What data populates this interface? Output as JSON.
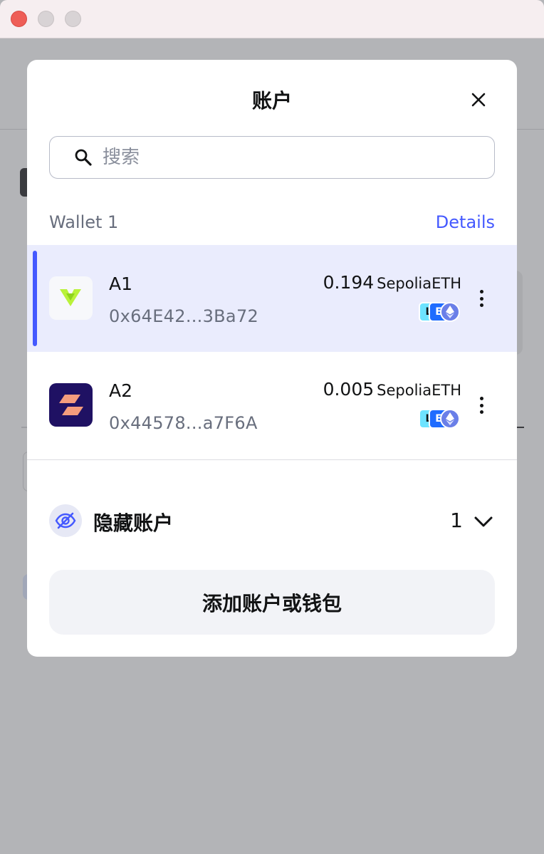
{
  "modal": {
    "title": "账户",
    "search_placeholder": "搜索"
  },
  "wallet": {
    "name": "Wallet 1",
    "details_label": "Details"
  },
  "accounts": [
    {
      "name": "A1",
      "address": "0x64E42...3Ba72",
      "balance": "0.194",
      "symbol": "SepoliaETH",
      "selected": true,
      "avatar_icon": "lime-chevron-icon"
    },
    {
      "name": "A2",
      "address": "0x44578...a7F6A",
      "balance": "0.005",
      "symbol": "SepoliaETH",
      "selected": false,
      "avatar_icon": "zigzag-logo-icon"
    }
  ],
  "network_badges": [
    "L",
    "E"
  ],
  "hidden_accounts": {
    "label": "隐藏账户",
    "count": "1"
  },
  "add_button_label": "添加账户或钱包",
  "colors": {
    "accent": "#4459ff",
    "selected_row": "#eaecfd",
    "overlay": "#b3b4b7"
  }
}
